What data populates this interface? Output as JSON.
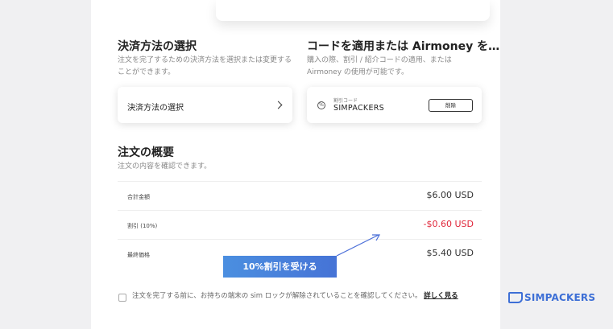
{
  "payment": {
    "heading": "決済方法の選択",
    "description": "注文を完了するための決済方法を選択または変更することができます。",
    "select_label": "決済方法の選択"
  },
  "coupon": {
    "heading": "コードを適用または Airmoney を…",
    "description": "購入の際、割引 / 紹介コードの適用、または Airmoney の使用が可能です。",
    "caption": "割引コード",
    "code": "SIMPACKERS",
    "remove_label": "削除"
  },
  "summary": {
    "heading": "注文の概要",
    "description": "注文の内容を確認できます。",
    "rows": [
      {
        "label": "合計金額",
        "value": "$6.00 USD"
      },
      {
        "label": "割引 (10%)",
        "value": "-$0.60 USD"
      },
      {
        "label": "最終価格",
        "value": "$5.40 USD"
      }
    ]
  },
  "promo_label": "10%割引を受ける",
  "consent": {
    "text": "注文を完了する前に、お持ちの端末の sim ロックが解除されていることを確認してください。",
    "link": "詳しく見る"
  },
  "brand": "SIMPACKERS",
  "colors": {
    "accent": "#3d6fd6",
    "discount": "#e0263a"
  }
}
